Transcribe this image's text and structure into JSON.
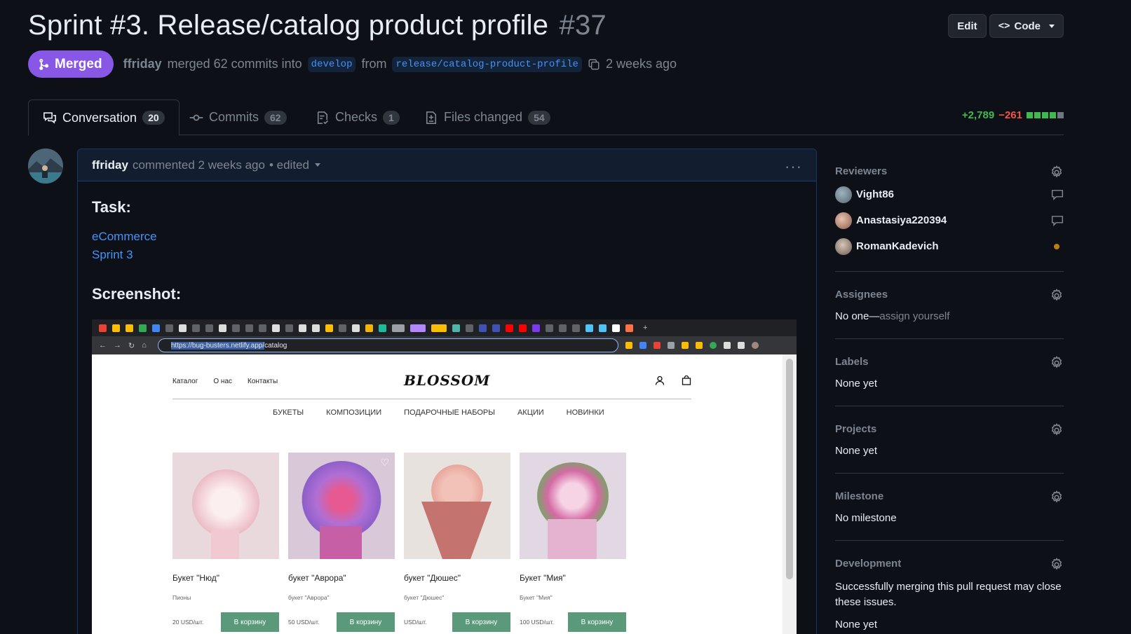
{
  "header": {
    "title": "Sprint #3. Release/catalog product profile",
    "number": "#37",
    "edit_label": "Edit",
    "code_label": "Code"
  },
  "meta": {
    "state": "Merged",
    "author": "ffriday",
    "action": "merged 62 commits into",
    "base_branch": "develop",
    "from_word": "from",
    "head_branch": "release/catalog-product-profile",
    "time": "2 weeks ago"
  },
  "tabs": [
    {
      "label": "Conversation",
      "count": "20",
      "icon": "conversation-icon"
    },
    {
      "label": "Commits",
      "count": "62",
      "icon": "commit-icon"
    },
    {
      "label": "Checks",
      "count": "1",
      "icon": "checklist-icon"
    },
    {
      "label": "Files changed",
      "count": "54",
      "icon": "file-diff-icon"
    }
  ],
  "diffstat": {
    "additions": "+2,789",
    "deletions": "−261"
  },
  "comment": {
    "author": "ffriday",
    "action": "commented 2 weeks ago",
    "edited": "• edited",
    "task_heading": "Task:",
    "links": [
      "eCommerce",
      "Sprint 3"
    ],
    "screenshot_heading": "Screenshot:"
  },
  "screenshot": {
    "url_selected": "https://bug-busters.netlify.app/",
    "url_rest": "catalog",
    "nav": [
      "Каталог",
      "О нас",
      "Контакты"
    ],
    "logo": "BLOSSOM",
    "categories": [
      "БУКЕТЫ",
      "КОМПОЗИЦИИ",
      "ПОДАРОЧНЫЕ НАБОРЫ",
      "АКЦИИ",
      "НОВИНКИ"
    ],
    "products": [
      {
        "name": "Букет \"Нюд\"",
        "sub": "Пионы",
        "price": "20 USD/шт.",
        "button": "В корзину"
      },
      {
        "name": "букет \"Аврора\"",
        "sub": "букет \"Аврора\"",
        "price": "50 USD/шт.",
        "button": "В корзину"
      },
      {
        "name": "букет \"Дюшес\"",
        "sub": "букет \"Дюшес\"",
        "price": "USD/шт.",
        "button": "В корзину"
      },
      {
        "name": "Букет \"Мия\"",
        "sub": "Букет \"Мия\"",
        "price": "100 USD/шт.",
        "button": "В корзину"
      }
    ]
  },
  "sidebar": {
    "reviewers": {
      "title": "Reviewers",
      "items": [
        {
          "name": "Vight86",
          "status": "comment-icon"
        },
        {
          "name": "Anastasiya220394",
          "status": "comment-icon"
        },
        {
          "name": "RomanKadevich",
          "status": "pending-dot"
        }
      ]
    },
    "assignees": {
      "title": "Assignees",
      "value": "No one—",
      "link": "assign yourself"
    },
    "labels": {
      "title": "Labels",
      "value": "None yet"
    },
    "projects": {
      "title": "Projects",
      "value": "None yet"
    },
    "milestone": {
      "title": "Milestone",
      "value": "No milestone"
    },
    "development": {
      "title": "Development",
      "text": "Successfully merging this pull request may close these issues.",
      "value": "None yet"
    }
  },
  "colors": {
    "merged": "#8957e5",
    "link": "#4493f8",
    "add": "#3fb950",
    "del": "#f85149",
    "bg": "#0d1117"
  }
}
